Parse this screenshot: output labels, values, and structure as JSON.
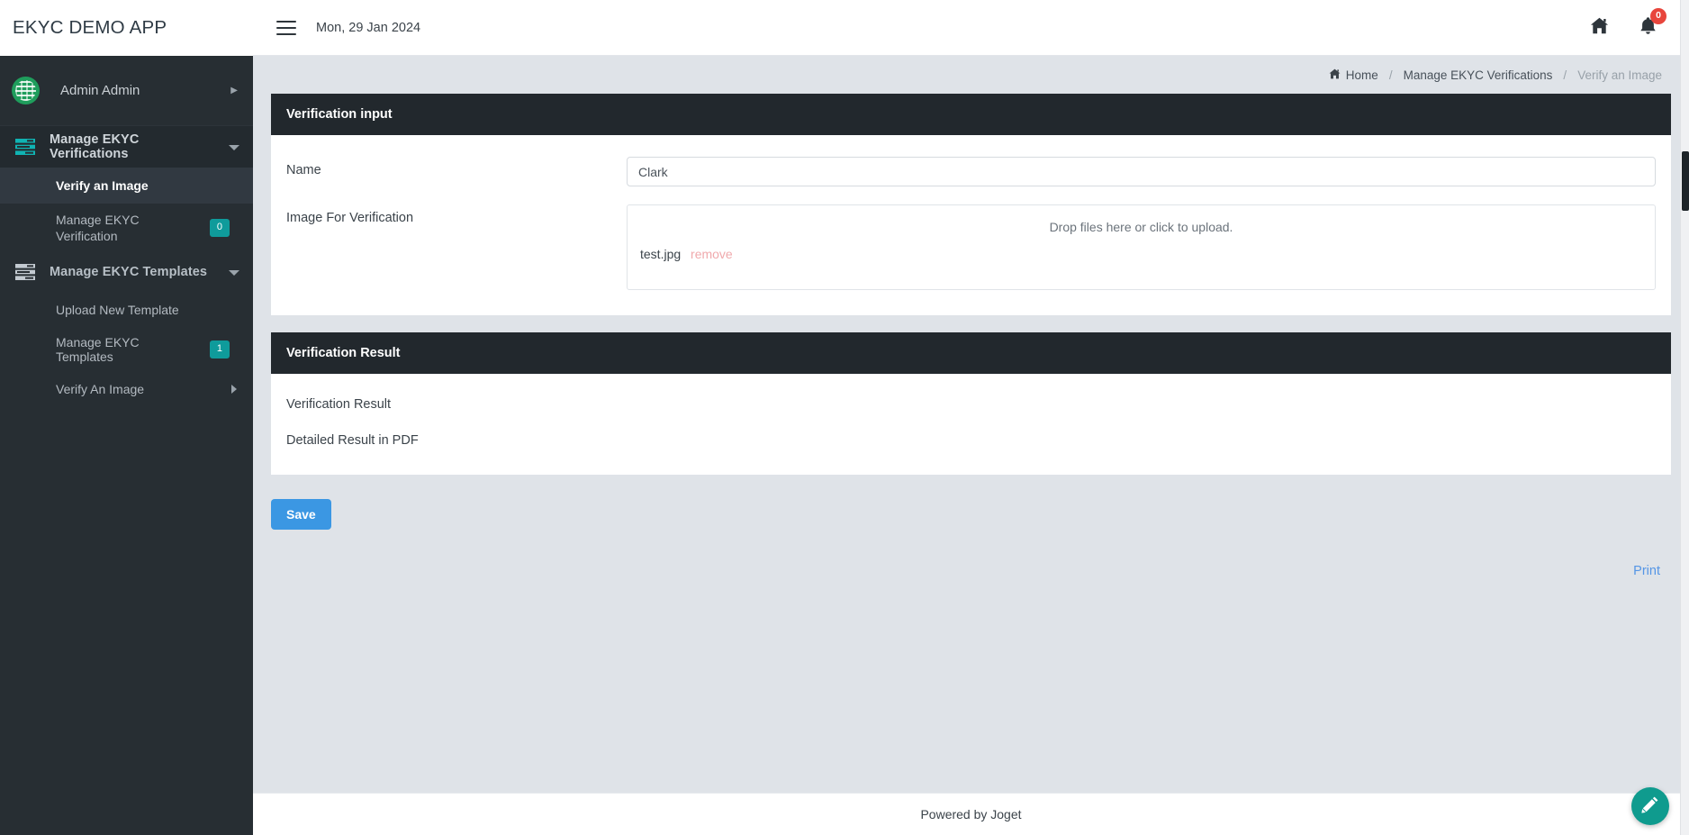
{
  "brand": {
    "title": "EKYC DEMO APP"
  },
  "sidebar": {
    "user": {
      "name": "Admin Admin",
      "avatar_icon": "user-avatar-identicon",
      "caret_icon": "caret-right-icon"
    },
    "groups": [
      {
        "label": "Manage EKYC Verifications",
        "icon": "list-teal-icon",
        "caret_icon": "caret-down-icon",
        "items": [
          {
            "label": "Verify an Image",
            "badge": "",
            "active": true
          },
          {
            "label": "Manage EKYC Verification",
            "badge": "0",
            "active": false
          }
        ]
      },
      {
        "label": "Manage EKYC Templates",
        "icon": "list-gray-icon",
        "caret_icon": "caret-down-icon",
        "items": [
          {
            "label": "Upload New Template",
            "badge": "",
            "active": false
          },
          {
            "label": "Manage EKYC Templates",
            "badge": "1",
            "active": false
          }
        ]
      }
    ],
    "collapsed_group": {
      "label": "Verify An Image",
      "caret_icon": "caret-right-icon"
    }
  },
  "topbar": {
    "menu_icon": "hamburger-menu-icon",
    "date": "Mon, 29 Jan 2024",
    "home_icon": "home-icon",
    "notification_icon": "bell-icon",
    "notification_count": "0"
  },
  "breadcrumb": {
    "home": "Home",
    "home_icon": "home-icon",
    "separator": "/",
    "parent": "Manage EKYC Verifications",
    "current": "Verify an Image"
  },
  "verification_input": {
    "title": "Verification input",
    "name_label": "Name",
    "name_value": "Clark",
    "name_placeholder": "",
    "image_label": "Image For Verification",
    "dropzone_hint": "Drop files here or click to upload.",
    "file_name": "test.jpg",
    "remove_label": "remove"
  },
  "verification_result": {
    "title": "Verification Result",
    "rows": [
      {
        "label": "Verification Result",
        "value": ""
      },
      {
        "label": "Detailed Result in PDF",
        "value": ""
      }
    ]
  },
  "actions": {
    "save_label": "Save",
    "print_label": "Print"
  },
  "footer": {
    "text": "Powered by Joget"
  },
  "fab": {
    "icon": "pencil-edit-icon"
  },
  "colors": {
    "sidebar_bg": "#272e33",
    "panel_head_bg": "#22282d",
    "accent_teal": "#0f9b9b",
    "save_blue": "#3b97e3",
    "badge_red": "#e8453c",
    "fab_teal": "#0f9b8e",
    "page_bg": "#dfe3e8"
  }
}
